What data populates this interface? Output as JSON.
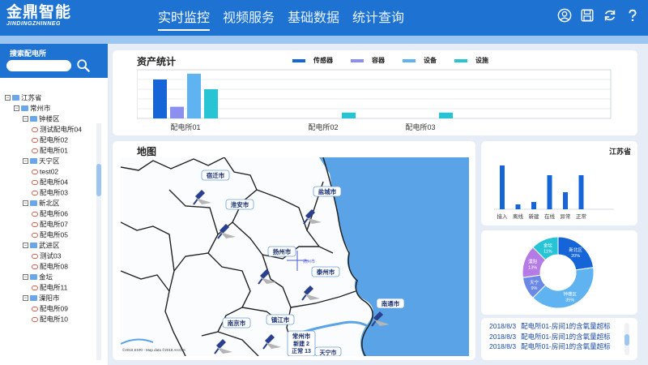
{
  "brand": {
    "name": "金鼎智能",
    "sub": "JINDINGZHINNEG"
  },
  "nav": [
    {
      "label": "实时监控",
      "active": true
    },
    {
      "label": "视频服务",
      "active": false
    },
    {
      "label": "基础数据",
      "active": false
    },
    {
      "label": "统计查询",
      "active": false
    }
  ],
  "header_icons": [
    "user-icon",
    "save-icon",
    "refresh-icon",
    "help-icon"
  ],
  "sidebar": {
    "title": "搜索配电所",
    "search_placeholder": "",
    "tree": [
      {
        "label": "江苏省",
        "level": 0,
        "type": "folder"
      },
      {
        "label": "常州市",
        "level": 1,
        "type": "folder"
      },
      {
        "label": "钟楼区",
        "level": 2,
        "type": "folder"
      },
      {
        "label": "测试配电所04",
        "level": 3,
        "type": "leaf"
      },
      {
        "label": "配电所02",
        "level": 3,
        "type": "leaf"
      },
      {
        "label": "配电所01",
        "level": 3,
        "type": "leaf"
      },
      {
        "label": "天宁区",
        "level": 2,
        "type": "folder"
      },
      {
        "label": "test02",
        "level": 3,
        "type": "leaf"
      },
      {
        "label": "配电所04",
        "level": 3,
        "type": "leaf"
      },
      {
        "label": "配电所03",
        "level": 3,
        "type": "leaf"
      },
      {
        "label": "新北区",
        "level": 2,
        "type": "folder"
      },
      {
        "label": "配电所06",
        "level": 3,
        "type": "leaf"
      },
      {
        "label": "配电所07",
        "level": 3,
        "type": "leaf"
      },
      {
        "label": "配电所05",
        "level": 3,
        "type": "leaf"
      },
      {
        "label": "武进区",
        "level": 2,
        "type": "folder"
      },
      {
        "label": "测试03",
        "level": 3,
        "type": "leaf"
      },
      {
        "label": "配电所08",
        "level": 3,
        "type": "leaf"
      },
      {
        "label": "金坛",
        "level": 2,
        "type": "folder"
      },
      {
        "label": "配电所11",
        "level": 3,
        "type": "leaf"
      },
      {
        "label": "溧阳市",
        "level": 2,
        "type": "folder"
      },
      {
        "label": "配电所09",
        "level": 3,
        "type": "leaf"
      },
      {
        "label": "配电所10",
        "level": 3,
        "type": "leaf"
      }
    ]
  },
  "asset_panel": {
    "title": "资产统计"
  },
  "map_panel": {
    "title": "地图",
    "cities": [
      "宿迁市",
      "淮安市",
      "盐城市",
      "扬州市",
      "泰州市",
      "南京市",
      "镇江市",
      "南通市",
      "常州市"
    ],
    "sub_labels": [
      "新建 2",
      "正常 13",
      "天宁市"
    ],
    "hover_label": "扬州市",
    "attribution": "©2018 ESRI - Map data ©2018 ArcGIS"
  },
  "province_panel": {
    "title": "江苏省"
  },
  "alerts": [
    {
      "date": "2018/8/3",
      "text": "配电所01-房间1的含氧量超标"
    },
    {
      "date": "2018/8/3",
      "text": "配电所01-房间1的含氧量超标"
    },
    {
      "date": "2018/8/3",
      "text": "配电所01-房间1的含氧量超标"
    }
  ],
  "colors": {
    "brand": "#1e73d2",
    "strip": "#9cc6f0",
    "sea": "#5aa3e6",
    "sensor": "#1565d8",
    "container": "#8a8ff0",
    "device": "#5fb3f0",
    "facility": "#27c4d6"
  },
  "chart_data": [
    {
      "type": "bar",
      "categories": [
        "配电所01",
        "配电所02",
        "配电所03"
      ],
      "series": [
        {
          "name": "传感器",
          "values": [
            4,
            0,
            0
          ]
        },
        {
          "name": "容器",
          "values": [
            1.2,
            0,
            0
          ]
        },
        {
          "name": "设备",
          "values": [
            4.6,
            0,
            0
          ]
        },
        {
          "name": "设施",
          "values": [
            3,
            0.6,
            0.6
          ]
        }
      ],
      "ylim": [
        0,
        5
      ]
    },
    {
      "type": "bar",
      "categories": [
        "接入",
        "离线",
        "新建",
        "在线",
        "异常",
        "正常"
      ],
      "values": [
        9,
        1,
        1.5,
        7,
        3.5,
        7
      ],
      "ylim": [
        0,
        10
      ]
    },
    {
      "type": "pie",
      "labels": [
        "新北区",
        "钟楼区",
        "天宁",
        "溧阳",
        "金坛"
      ],
      "values": [
        20,
        35,
        9,
        13,
        11
      ],
      "label_texts": [
        "新北区\n20%",
        "钟楼区\n35%",
        "天宁\n9%",
        "溧阳\n13%",
        "金坛\n11%"
      ]
    }
  ]
}
